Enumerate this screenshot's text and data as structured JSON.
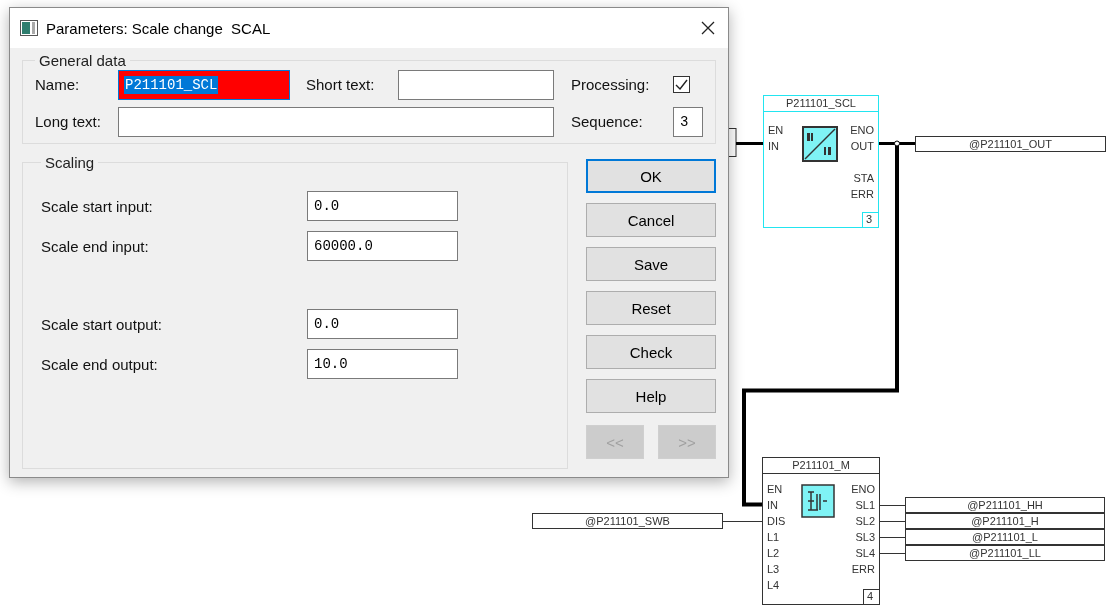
{
  "window": {
    "title": "Parameters: Scale change  SCAL"
  },
  "general_data": {
    "legend": "General data",
    "name": {
      "label": "Name:",
      "value": "P211101_SCL",
      "invalid": true,
      "text_selected": true
    },
    "short_text": {
      "label": "Short text:"
    },
    "long_text": {
      "label": "Long text:"
    },
    "processing": {
      "label": "Processing:",
      "checked": true
    },
    "sequence": {
      "label": "Sequence:",
      "value": "3"
    }
  },
  "scaling": {
    "legend": "Scaling",
    "sections": [
      [
        {
          "label": "Scale start input:",
          "value": "0.0"
        },
        {
          "label": "Scale end input:",
          "value": "60000.0"
        }
      ],
      [
        {
          "label": "Scale start output:",
          "value": "0.0"
        },
        {
          "label": "Scale end output:",
          "value": "10.0"
        }
      ]
    ]
  },
  "buttons": [
    {
      "label": "OK",
      "focused": true
    },
    {
      "label": "Cancel",
      "focused": false
    },
    {
      "label": "Save",
      "focused": false
    },
    {
      "label": "Reset",
      "focused": false
    },
    {
      "label": "Check",
      "focused": false
    },
    {
      "label": "Help",
      "focused": false
    }
  ],
  "nav_buttons": [
    {
      "label": "<<",
      "disabled": true
    },
    {
      "label": ">>",
      "disabled": true
    }
  ],
  "diagram": {
    "blocks": [
      {
        "kind": "scale",
        "title": "P211101_SCL",
        "selected": true,
        "input_groups": [
          [
            "EN",
            "IN"
          ]
        ],
        "output_groups": [
          [
            "ENO",
            "OUT"
          ],
          [
            "STA",
            "ERR"
          ]
        ],
        "number": "3"
      },
      {
        "kind": "limit",
        "title": "P211101_M",
        "selected": false,
        "input_groups": [
          [
            "EN",
            "IN",
            "DIS",
            "L1",
            "L2",
            "L3",
            "L4"
          ]
        ],
        "output_groups": [
          [
            "ENO",
            "SL1",
            "SL2",
            "SL3",
            "SL4",
            "ERR"
          ]
        ],
        "number": "4"
      }
    ],
    "tags": [
      "@P211101_OUT",
      "@P211101_HH",
      "@P211101_SWB",
      "@P211101_H",
      "@P211101_L",
      "@P211101_LL"
    ]
  }
}
